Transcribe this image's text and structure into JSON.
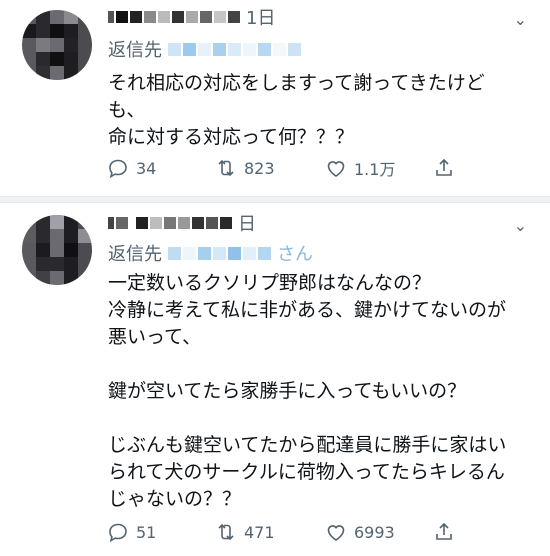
{
  "tweets": [
    {
      "time": "1日",
      "more": "⌄",
      "reply_prefix": "返信先",
      "reply_suffix": "",
      "text": "それ相応の対応をしますって謝ってきたけど\nも、\n命に対する対応って何？？？",
      "counts": {
        "reply": "34",
        "retweet": "823",
        "like": "1.1万"
      }
    },
    {
      "time": "日",
      "more": "⌄",
      "reply_prefix": "返信先",
      "reply_suffix": "さん",
      "text": "一定数いるクソリプ野郎はなんなの？\n冷静に考えて私に非がある、鍵かけてないのが\n悪いって、\n\n鍵が空いてたら家勝手に入ってもいいの？\n\nじぶんも鍵空いてたから配達員に勝手に家はい\nられて犬のサークルに荷物入ってたらキレるん\nじゃないの？？",
      "counts": {
        "reply": "51",
        "retweet": "471",
        "like": "6993"
      }
    }
  ],
  "icons": {
    "reply": "reply-icon",
    "retweet": "retweet-icon",
    "like": "heart-icon",
    "share": "share-icon",
    "more": "chevron-down-icon"
  },
  "colors": {
    "text": "#0f1419",
    "secondary": "#536471",
    "link": "#1d9bf0",
    "separator": "#f0f2f4"
  }
}
